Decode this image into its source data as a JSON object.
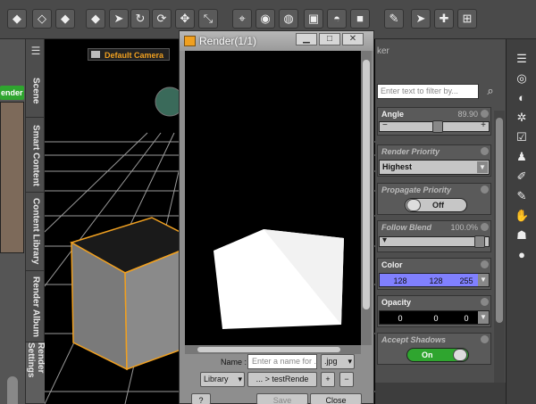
{
  "toolbar": {
    "icons": [
      "universe-icon",
      "figure-icon",
      "node-icon",
      "move-icon",
      "select-arrow-icon",
      "rotate-icon",
      "cursor-icon",
      "translate-icon",
      "scale-icon",
      "node-select-icon",
      "render-icon",
      "spot-render-icon",
      "iray-icon",
      "lights-icon",
      "shaders-icon",
      "brush-icon",
      "arrow-icon",
      "gizmo-icon",
      "more-icon"
    ],
    "glyphs": [
      "◆",
      "◇",
      "◆",
      "◆",
      "➤",
      "↻",
      "⟳",
      "✥",
      "⤡",
      "⌖",
      "◉",
      "◍",
      "▣",
      "◓",
      "■",
      "✎",
      "➤",
      "✚",
      "⊞"
    ]
  },
  "left_panel": {
    "render_button": "ender",
    "tabs": [
      {
        "label": "Scene"
      },
      {
        "label": "Smart Content"
      },
      {
        "label": "Content Library"
      },
      {
        "label": "Render Album"
      },
      {
        "label": "Render Settings",
        "active": true
      }
    ]
  },
  "viewport": {
    "camera_label": "Default Camera"
  },
  "render_window": {
    "title": "Render(1/1)",
    "name_label": "Name :",
    "name_placeholder": "Enter a name for ...",
    "format": ".jpg",
    "library_label": "Library",
    "path_label": "... > testRende",
    "add_label": "+",
    "remove_label": "−",
    "help_label": "?",
    "save_label": "Save",
    "close_label": "Close"
  },
  "properties": {
    "header": "ker",
    "filter_placeholder": "Enter text to filter by...",
    "angle": {
      "title": "Angle",
      "value": "89.90",
      "level": 0.5
    },
    "render_priority": {
      "title": "Render Priority",
      "value": "Highest"
    },
    "propagate_priority": {
      "title": "Propagate Priority",
      "value": "Off"
    },
    "follow_blend": {
      "title": "Follow Blend",
      "value": "100.0%",
      "level": 1.0
    },
    "color": {
      "title": "Color",
      "r": "128",
      "g": "128",
      "b": "255",
      "swatch": "#8080ff"
    },
    "opacity": {
      "title": "Opacity",
      "r": "0",
      "g": "0",
      "b": "0"
    },
    "accept_shadows": {
      "title": "Accept Shadows",
      "value": "On"
    }
  },
  "right_tools": {
    "icons": [
      "pane-menu-icon",
      "parameters-icon",
      "surfaces-icon",
      "lights-settings-icon",
      "shader-mixer-icon",
      "posing-icon",
      "joint-editor-icon",
      "property-hierarchy-icon",
      "figure-setup-icon",
      "geometry-editor-icon",
      "environment-icon"
    ],
    "glyphs": [
      "☰",
      "◎",
      "◐",
      "✲",
      "☑",
      "♟",
      "✐",
      "✎",
      "✋",
      "☗",
      "●"
    ]
  }
}
